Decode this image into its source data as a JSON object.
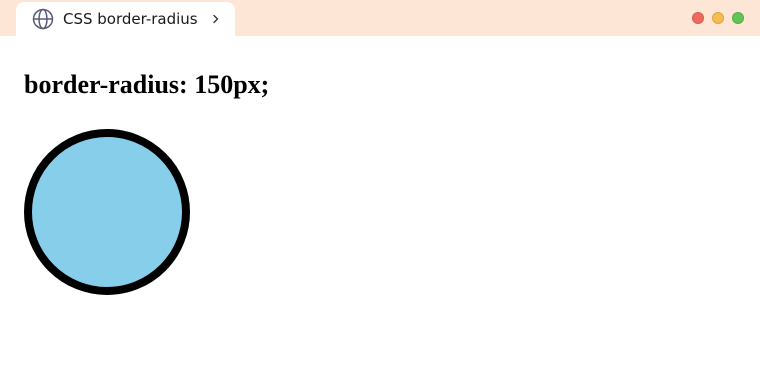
{
  "browser": {
    "tab": {
      "title": "CSS border-radius",
      "icon": "globe-icon",
      "chevron": "chevron-right-icon"
    },
    "window_controls": {
      "close_color": "#ee6a5f",
      "minimize_color": "#f5bd4f",
      "maximize_color": "#61c454"
    },
    "titlebar_color": "#fde6d6"
  },
  "page": {
    "heading": "border-radius: 150px;",
    "demo_box": {
      "fill_color": "#87ceeb",
      "border_color": "#000000"
    }
  }
}
